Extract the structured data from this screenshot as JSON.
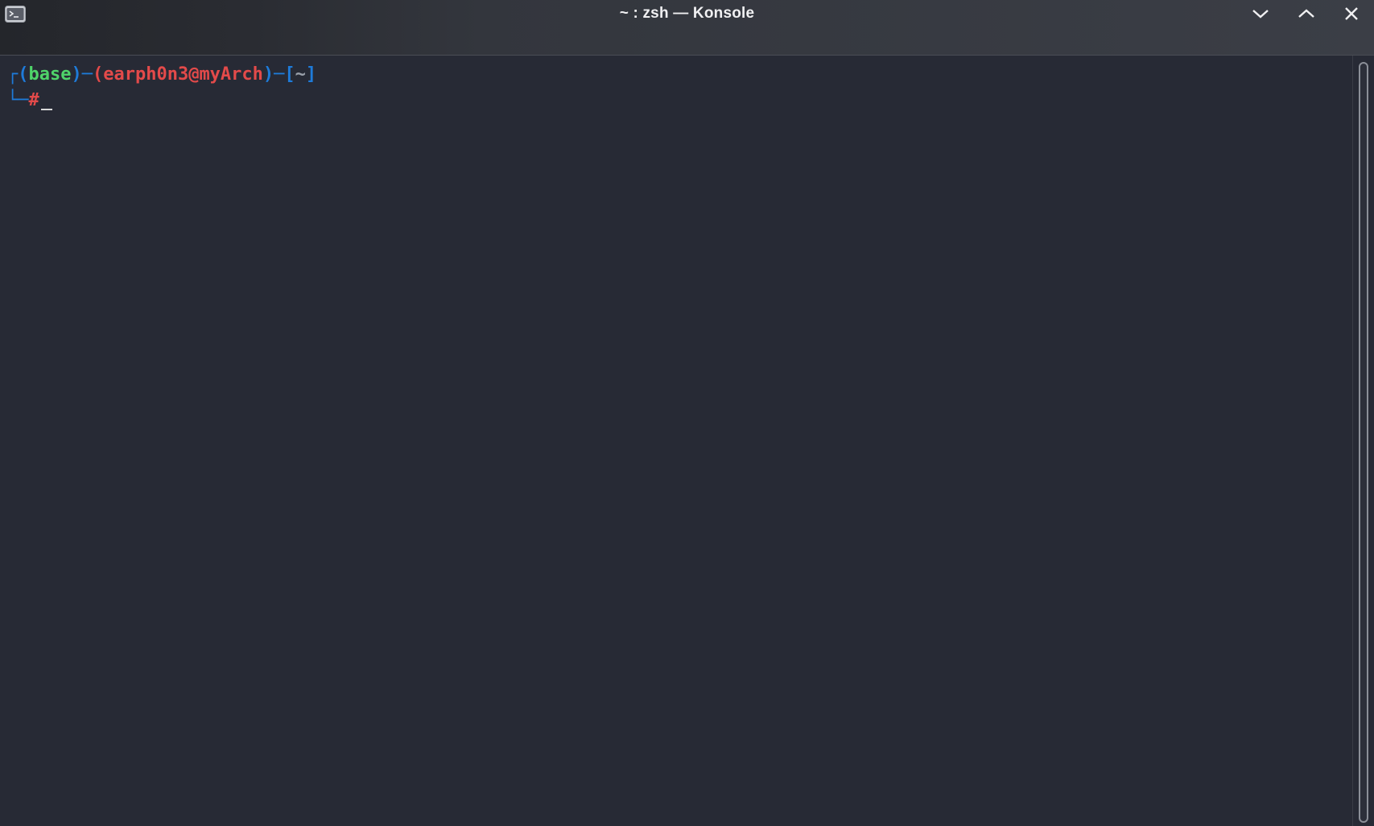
{
  "window": {
    "title": "~ : zsh — Konsole",
    "app_icon": "terminal-icon",
    "controls": {
      "minimize_icon": "chevron-down-icon",
      "maximize_icon": "chevron-up-icon",
      "close_icon": "close-icon"
    }
  },
  "terminal": {
    "prompt": {
      "corner_top": "┌",
      "open_paren_1": "(",
      "env": "base",
      "close_paren_1": ")",
      "dash_1": "─",
      "open_paren_2": "(",
      "user_host": "earph0n3@myArch",
      "close_paren_2": ")",
      "dash_2": "─",
      "open_bracket": "[",
      "cwd": "~",
      "close_bracket": "]",
      "corner_bottom": "└─",
      "symbol": "#"
    }
  },
  "colors": {
    "background": "#272a35",
    "bracket_blue": "#1e7bd9",
    "env_green": "#4fd46a",
    "user_red": "#e34a4a",
    "cwd_grey": "#9aa0aa"
  }
}
